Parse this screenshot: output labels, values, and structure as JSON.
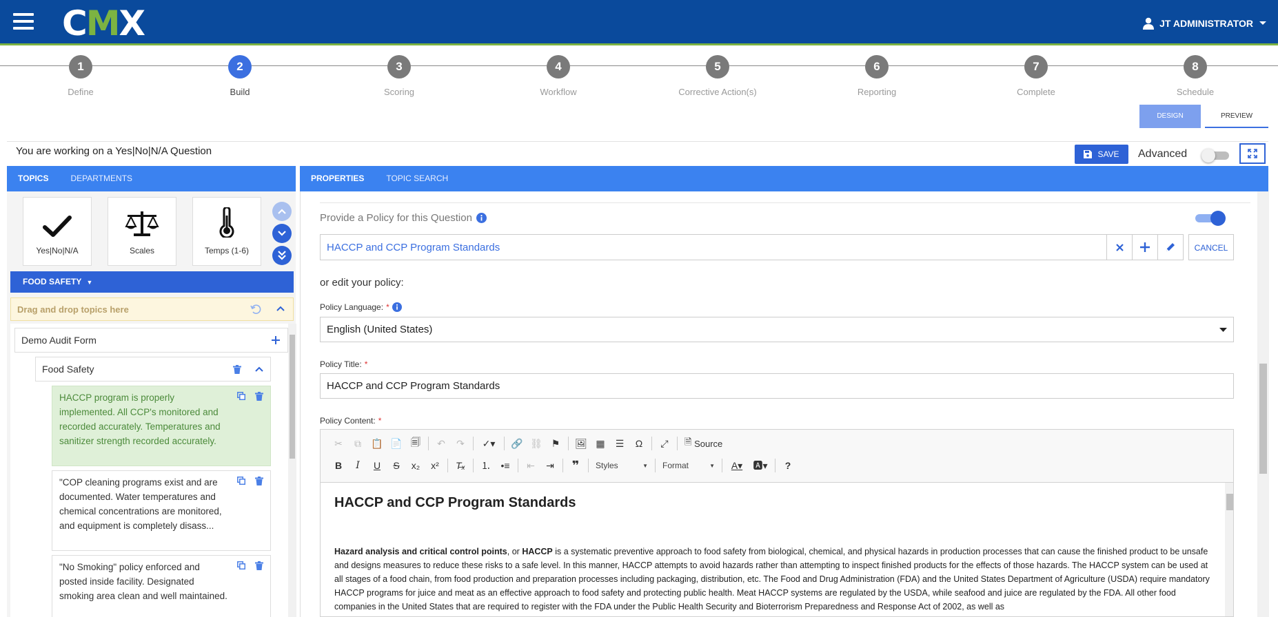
{
  "header": {
    "logo": {
      "prefix": "C",
      "highlight": "M",
      "suffix": "X"
    },
    "user_name": "JT ADMINISTRATOR"
  },
  "steps": [
    {
      "number": "1",
      "label": "Define"
    },
    {
      "number": "2",
      "label": "Build",
      "active": true
    },
    {
      "number": "3",
      "label": "Scoring"
    },
    {
      "number": "4",
      "label": "Workflow"
    },
    {
      "number": "5",
      "label": "Corrective Action(s)"
    },
    {
      "number": "6",
      "label": "Reporting"
    },
    {
      "number": "7",
      "label": "Complete"
    },
    {
      "number": "8",
      "label": "Schedule"
    }
  ],
  "view_toggle": {
    "design": "DESIGN",
    "preview": "PREVIEW",
    "selected": "DESIGN"
  },
  "working_bar": {
    "text": "You are working on a Yes|No|N/A Question",
    "save_label": "SAVE",
    "advanced_label": "Advanced",
    "advanced_on": false
  },
  "left_tabs": [
    "TOPICS",
    "DEPARTMENTS"
  ],
  "right_tabs": [
    "PROPERTIES",
    "TOPIC SEARCH"
  ],
  "question_types": [
    {
      "name": "Yes|No|N/A",
      "icon": "check-icon"
    },
    {
      "name": "Scales",
      "icon": "scales-icon"
    },
    {
      "name": "Temps (1-6)",
      "icon": "thermometer-icon"
    }
  ],
  "category": "FOOD SAFETY",
  "dropzone_label": "Drag and drop topics here",
  "tree": {
    "form": "Demo Audit Form",
    "section": "Food Safety",
    "questions": [
      {
        "text": "HACCP program is properly implemented. All CCP's monitored and recorded accurately. Temperatures and sanitizer strength recorded accurately.",
        "selected": true
      },
      {
        "text": "\"COP cleaning programs exist and are documented. Water temperatures and chemical concentrations are monitored, and equipment is completely disass...",
        "selected": false
      },
      {
        "text": "\"No Smoking\" policy enforced and posted inside facility. Designated smoking area clean and well maintained.",
        "selected": false
      }
    ]
  },
  "properties": {
    "policy_question_label": "Provide a Policy for this Question",
    "policy_enabled": true,
    "policy_selected": "HACCP and CCP Program Standards",
    "cancel_label": "CANCEL",
    "or_edit": "or edit your policy:",
    "language_label": "Policy Language:",
    "language_value": "English (United States)",
    "title_label": "Policy Title:",
    "title_value": "HACCP and CCP Program Standards",
    "content_label": "Policy Content:",
    "required_mark": "*"
  },
  "editor": {
    "source_label": "Source",
    "styles_label": "Styles",
    "format_label": "Format",
    "doc_title": "HACCP and CCP Program Standards",
    "para_bold1": "Hazard analysis and critical control points",
    "para_mid": ", or ",
    "para_bold2": "HACCP",
    "para_rest": " is a systematic preventive approach to food safety from biological, chemical, and physical hazards in production processes that can cause the finished product to be unsafe and designs measures to reduce these risks to a safe level. In this manner, HACCP attempts to avoid hazards rather than attempting to inspect finished products for the effects of those hazards. The HACCP system can be used at all stages of a food chain, from food production and preparation processes including packaging, distribution, etc. The Food and Drug Administration (FDA) and the United States Department of Agriculture (USDA) require mandatory HACCP programs for juice and meat as an effective approach to food safety and protecting public health. Meat HACCP systems are regulated by the USDA, while seafood and juice are regulated by the FDA. All other food companies in the United States that are required to register with the FDA under the Public Health Security and Bioterrorism Preparedness and Response Act of 2002, as well as"
  },
  "colors": {
    "header_bg": "#0a4a9c",
    "accent_green": "#7cb342",
    "primary_blue": "#2e62d6",
    "tab_blue": "#3b82f0"
  }
}
